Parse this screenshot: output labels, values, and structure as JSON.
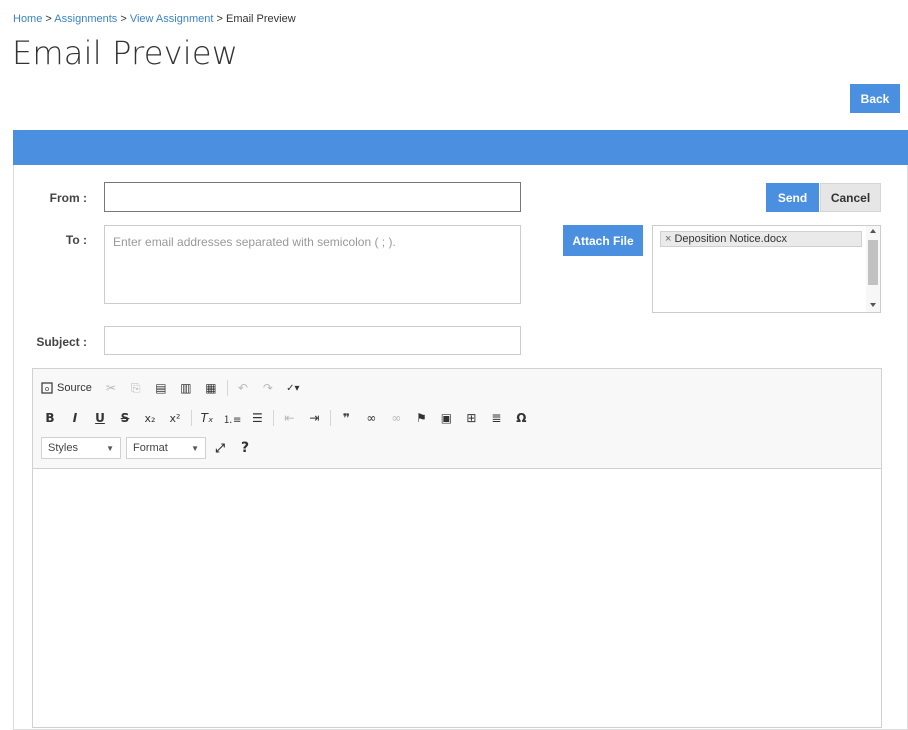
{
  "breadcrumb": {
    "home": "Home",
    "assignments": "Assignments",
    "view_assignment": "View Assignment",
    "current": "Email Preview",
    "separator": ">"
  },
  "page_title": "Email Preview",
  "back_label": "Back",
  "form": {
    "from_label": "From :",
    "from_value": "",
    "to_label": "To :",
    "to_placeholder": "Enter email addresses separated with semicolon ( ; ).",
    "subject_label": "Subject :",
    "subject_value": "",
    "send_label": "Send",
    "cancel_label": "Cancel",
    "attach_label": "Attach File"
  },
  "attachments": [
    {
      "remove_icon": "×",
      "name": "Deposition Notice.docx"
    }
  ],
  "editor": {
    "source_label": "Source",
    "styles_label": "Styles",
    "format_label": "Format"
  },
  "colors": {
    "accent": "#4a8fe0",
    "link": "#3a83c9"
  }
}
